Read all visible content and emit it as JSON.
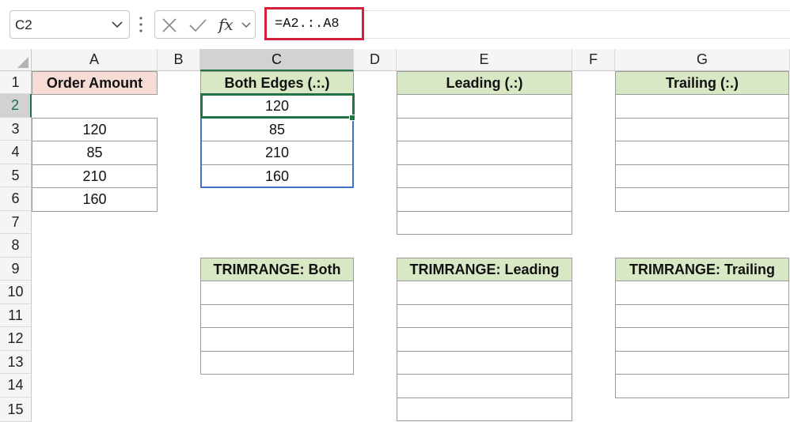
{
  "formula_bar": {
    "name_box": "C2",
    "fx_label": "fx",
    "formula": "=A2.:.A8"
  },
  "columns": [
    "A",
    "B",
    "C",
    "D",
    "E",
    "F",
    "G"
  ],
  "rows": [
    "1",
    "2",
    "3",
    "4",
    "5",
    "6",
    "7",
    "8",
    "9",
    "10",
    "11",
    "12",
    "13",
    "14",
    "15"
  ],
  "cells": {
    "A1": "Order Amount",
    "A3": "120",
    "A4": "85",
    "A5": "210",
    "A6": "160",
    "C1": "Both Edges (.:.)",
    "C2": "120",
    "C3": "85",
    "C4": "210",
    "C5": "160",
    "E1": "Leading (.:)",
    "G1": "Trailing (:.)",
    "C9": "TRIMRANGE: Both",
    "E9": "TRIMRANGE: Leading",
    "G9": "TRIMRANGE: Trailing"
  },
  "colors": {
    "header_green": "#d9e8c4",
    "header_pink": "#f7dcd6",
    "selection_green": "#217346",
    "spill_blue": "#4472c4",
    "formula_highlight": "#d4213d"
  },
  "selected_cell": "C2"
}
